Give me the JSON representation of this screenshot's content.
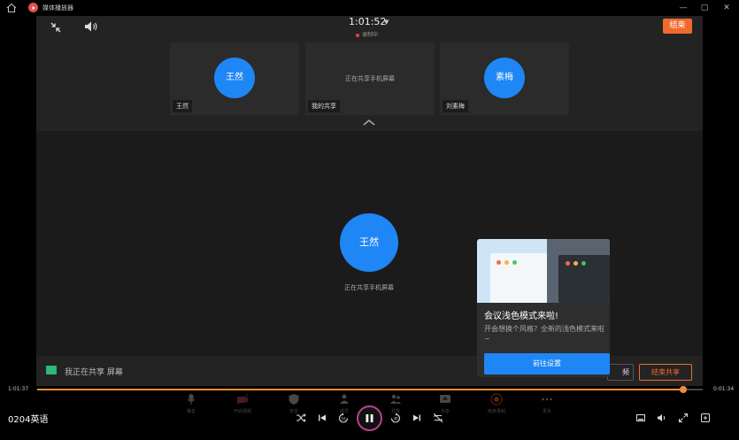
{
  "window": {
    "title": "媒体播放器",
    "minimize": "—",
    "maximize": "▢",
    "close": "✕"
  },
  "meeting": {
    "timer": "1:01:52",
    "recording": "录制中",
    "end_button": "结束",
    "tiles": [
      {
        "avatar": "王然",
        "label": "王然"
      },
      {
        "center_text": "正在共享手机屏幕",
        "label": "我的共享"
      },
      {
        "avatar": "素梅",
        "label": "刘素梅"
      }
    ],
    "main_avatar": "王然",
    "main_caption": "正在共享手机屏幕",
    "share_status": "我正在共享 屏幕",
    "frame_button": "频",
    "end_share_button": "结束共享",
    "toolbar": [
      "静音",
      "开启视频",
      "安全",
      "成员",
      "共享",
      "结束录制",
      "更多"
    ]
  },
  "popup": {
    "title": "会议浅色模式来啦!",
    "description": "开会想换个风格？全新的浅色模式来啦~",
    "cta": "前往设置"
  },
  "player": {
    "elapsed": "1:01:37",
    "total": "0:01:34",
    "progress": 0.971,
    "filename": "0204英语",
    "accent": "#f28c3a"
  }
}
